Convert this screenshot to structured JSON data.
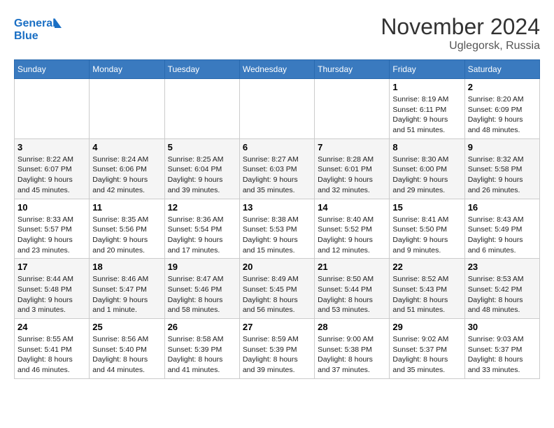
{
  "header": {
    "logo_line1": "General",
    "logo_line2": "Blue",
    "month": "November 2024",
    "location": "Uglegorsk, Russia"
  },
  "days_of_week": [
    "Sunday",
    "Monday",
    "Tuesday",
    "Wednesday",
    "Thursday",
    "Friday",
    "Saturday"
  ],
  "weeks": [
    [
      {
        "day": "",
        "info": ""
      },
      {
        "day": "",
        "info": ""
      },
      {
        "day": "",
        "info": ""
      },
      {
        "day": "",
        "info": ""
      },
      {
        "day": "",
        "info": ""
      },
      {
        "day": "1",
        "info": "Sunrise: 8:19 AM\nSunset: 6:11 PM\nDaylight: 9 hours and 51 minutes."
      },
      {
        "day": "2",
        "info": "Sunrise: 8:20 AM\nSunset: 6:09 PM\nDaylight: 9 hours and 48 minutes."
      }
    ],
    [
      {
        "day": "3",
        "info": "Sunrise: 8:22 AM\nSunset: 6:07 PM\nDaylight: 9 hours and 45 minutes."
      },
      {
        "day": "4",
        "info": "Sunrise: 8:24 AM\nSunset: 6:06 PM\nDaylight: 9 hours and 42 minutes."
      },
      {
        "day": "5",
        "info": "Sunrise: 8:25 AM\nSunset: 6:04 PM\nDaylight: 9 hours and 39 minutes."
      },
      {
        "day": "6",
        "info": "Sunrise: 8:27 AM\nSunset: 6:03 PM\nDaylight: 9 hours and 35 minutes."
      },
      {
        "day": "7",
        "info": "Sunrise: 8:28 AM\nSunset: 6:01 PM\nDaylight: 9 hours and 32 minutes."
      },
      {
        "day": "8",
        "info": "Sunrise: 8:30 AM\nSunset: 6:00 PM\nDaylight: 9 hours and 29 minutes."
      },
      {
        "day": "9",
        "info": "Sunrise: 8:32 AM\nSunset: 5:58 PM\nDaylight: 9 hours and 26 minutes."
      }
    ],
    [
      {
        "day": "10",
        "info": "Sunrise: 8:33 AM\nSunset: 5:57 PM\nDaylight: 9 hours and 23 minutes."
      },
      {
        "day": "11",
        "info": "Sunrise: 8:35 AM\nSunset: 5:56 PM\nDaylight: 9 hours and 20 minutes."
      },
      {
        "day": "12",
        "info": "Sunrise: 8:36 AM\nSunset: 5:54 PM\nDaylight: 9 hours and 17 minutes."
      },
      {
        "day": "13",
        "info": "Sunrise: 8:38 AM\nSunset: 5:53 PM\nDaylight: 9 hours and 15 minutes."
      },
      {
        "day": "14",
        "info": "Sunrise: 8:40 AM\nSunset: 5:52 PM\nDaylight: 9 hours and 12 minutes."
      },
      {
        "day": "15",
        "info": "Sunrise: 8:41 AM\nSunset: 5:50 PM\nDaylight: 9 hours and 9 minutes."
      },
      {
        "day": "16",
        "info": "Sunrise: 8:43 AM\nSunset: 5:49 PM\nDaylight: 9 hours and 6 minutes."
      }
    ],
    [
      {
        "day": "17",
        "info": "Sunrise: 8:44 AM\nSunset: 5:48 PM\nDaylight: 9 hours and 3 minutes."
      },
      {
        "day": "18",
        "info": "Sunrise: 8:46 AM\nSunset: 5:47 PM\nDaylight: 9 hours and 1 minute."
      },
      {
        "day": "19",
        "info": "Sunrise: 8:47 AM\nSunset: 5:46 PM\nDaylight: 8 hours and 58 minutes."
      },
      {
        "day": "20",
        "info": "Sunrise: 8:49 AM\nSunset: 5:45 PM\nDaylight: 8 hours and 56 minutes."
      },
      {
        "day": "21",
        "info": "Sunrise: 8:50 AM\nSunset: 5:44 PM\nDaylight: 8 hours and 53 minutes."
      },
      {
        "day": "22",
        "info": "Sunrise: 8:52 AM\nSunset: 5:43 PM\nDaylight: 8 hours and 51 minutes."
      },
      {
        "day": "23",
        "info": "Sunrise: 8:53 AM\nSunset: 5:42 PM\nDaylight: 8 hours and 48 minutes."
      }
    ],
    [
      {
        "day": "24",
        "info": "Sunrise: 8:55 AM\nSunset: 5:41 PM\nDaylight: 8 hours and 46 minutes."
      },
      {
        "day": "25",
        "info": "Sunrise: 8:56 AM\nSunset: 5:40 PM\nDaylight: 8 hours and 44 minutes."
      },
      {
        "day": "26",
        "info": "Sunrise: 8:58 AM\nSunset: 5:39 PM\nDaylight: 8 hours and 41 minutes."
      },
      {
        "day": "27",
        "info": "Sunrise: 8:59 AM\nSunset: 5:39 PM\nDaylight: 8 hours and 39 minutes."
      },
      {
        "day": "28",
        "info": "Sunrise: 9:00 AM\nSunset: 5:38 PM\nDaylight: 8 hours and 37 minutes."
      },
      {
        "day": "29",
        "info": "Sunrise: 9:02 AM\nSunset: 5:37 PM\nDaylight: 8 hours and 35 minutes."
      },
      {
        "day": "30",
        "info": "Sunrise: 9:03 AM\nSunset: 5:37 PM\nDaylight: 8 hours and 33 minutes."
      }
    ]
  ]
}
